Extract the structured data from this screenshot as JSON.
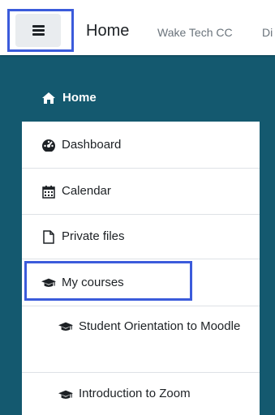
{
  "topbar": {
    "menu_button_icon": "hamburger-icon",
    "home": "Home",
    "site_name": "Wake Tech CC",
    "overflow_text": "Di"
  },
  "drawer": {
    "home": {
      "label": "Home",
      "icon": "home-icon"
    },
    "items": [
      {
        "label": "Dashboard",
        "icon": "dashboard-icon"
      },
      {
        "label": "Calendar",
        "icon": "calendar-icon"
      },
      {
        "label": "Private files",
        "icon": "file-icon"
      },
      {
        "label": "My courses",
        "icon": "graduation-cap-icon"
      }
    ],
    "courses": [
      {
        "label": "Student Orientation to Moodle",
        "icon": "graduation-cap-icon"
      },
      {
        "label": "Introduction to Zoom",
        "icon": "graduation-cap-icon"
      }
    ]
  },
  "colors": {
    "drawer_bg": "#14596f",
    "highlight": "#3b5bdb",
    "text": "#1d2125"
  }
}
